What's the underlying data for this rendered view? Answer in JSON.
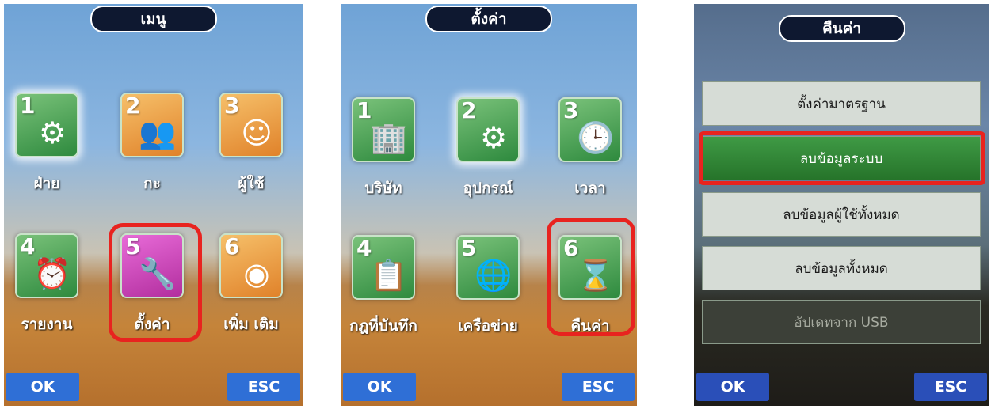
{
  "screen1": {
    "title": "เมนู",
    "items": [
      {
        "num": "1",
        "label": "ฝ่าย",
        "icon": "gear-paper-icon"
      },
      {
        "num": "2",
        "label": "กะ",
        "icon": "users-clock-icon"
      },
      {
        "num": "3",
        "label": "ผู้ใช้",
        "icon": "user-avatar-icon"
      },
      {
        "num": "4",
        "label": "รายงาน",
        "icon": "report-clock-icon"
      },
      {
        "num": "5",
        "label": "ตั้งค่า",
        "icon": "tools-icon"
      },
      {
        "num": "6",
        "label": "เพิ่ม เติม",
        "icon": "disc-icon"
      }
    ],
    "ok": "OK",
    "esc": "ESC"
  },
  "screen2": {
    "title": "ตั้งค่า",
    "items": [
      {
        "num": "1",
        "label": "บริษัท",
        "icon": "building-icon"
      },
      {
        "num": "2",
        "label": "อุปกรณ์",
        "icon": "gear-icon"
      },
      {
        "num": "3",
        "label": "เวลา",
        "icon": "clock-icon"
      },
      {
        "num": "4",
        "label": "กฎที่บันทึก",
        "icon": "clipboard-icon"
      },
      {
        "num": "5",
        "label": "เครือข่าย",
        "icon": "network-icon"
      },
      {
        "num": "6",
        "label": "คืนค่า",
        "icon": "hourglass-icon"
      }
    ],
    "ok": "OK",
    "esc": "ESC"
  },
  "screen3": {
    "title": "คืนค่า",
    "items": [
      "ตั้งค่ามาตรฐาน",
      "ลบข้อมูลระบบ",
      "ลบข้อมูลผู้ใช้ทั้งหมด",
      "ลบข้อมูลทั้งหมด",
      "อัปเดทจาก USB"
    ],
    "ok": "OK",
    "esc": "ESC"
  },
  "colors": {
    "highlight": "#e8231f",
    "softkey": "#2f6fd6",
    "title_bg": "#0e1830",
    "active_item": "#2e8a3e"
  }
}
